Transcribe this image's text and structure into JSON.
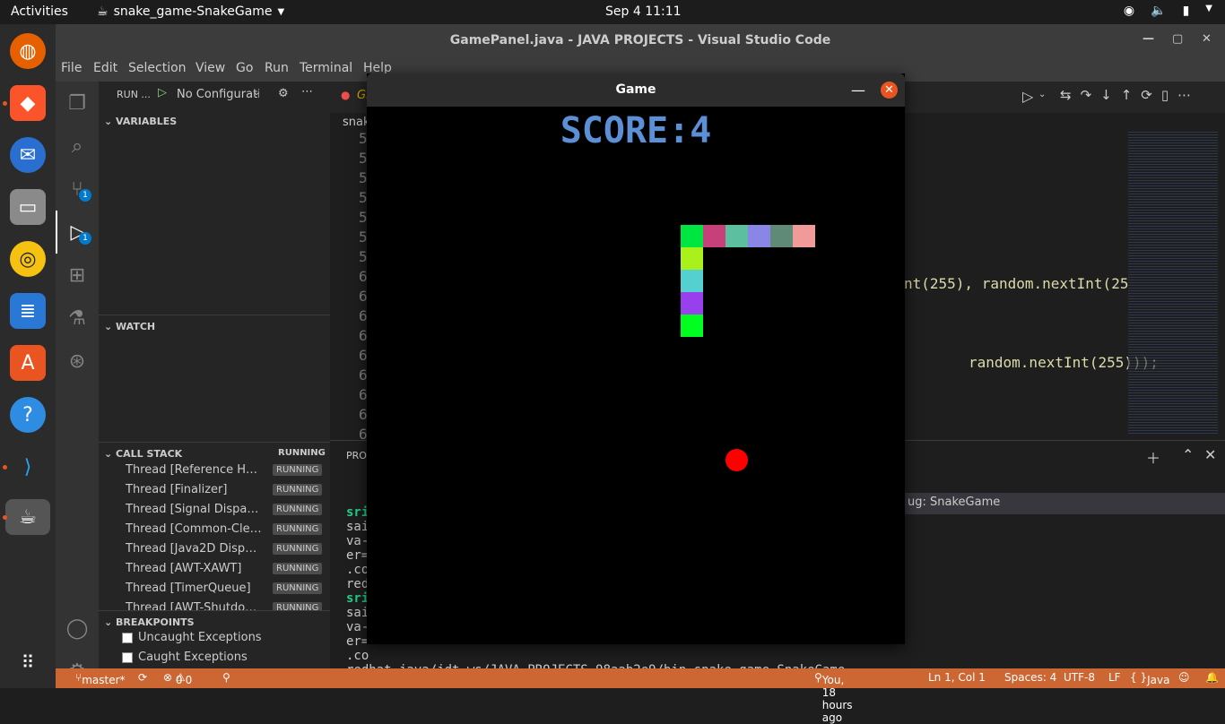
{
  "top": {
    "activities": "Activities",
    "app": "snake_game-SnakeGame",
    "clock": "Sep 4  11:11"
  },
  "window": {
    "title": "GamePanel.java - JAVA PROJECTS - Visual Studio Code"
  },
  "menu": {
    "file": "File",
    "edit": "Edit",
    "selection": "Selection",
    "view": "View",
    "go": "Go",
    "run": "Run",
    "terminal": "Terminal",
    "help": "Help"
  },
  "activity": {
    "scm_badge": "1",
    "debug_badge": "1"
  },
  "sidebar": {
    "run_label": "RUN ...",
    "config": "No Configurati",
    "variables": "VARIABLES",
    "watch": "WATCH",
    "callstack": "CALL STACK",
    "callstack_status": "RUNNING",
    "threads": [
      {
        "name": "Thread [Reference Han...",
        "state": "RUNNING"
      },
      {
        "name": "Thread [Finalizer]",
        "state": "RUNNING"
      },
      {
        "name": "Thread [Signal Dispatch...",
        "state": "RUNNING"
      },
      {
        "name": "Thread [Common-Clean...",
        "state": "RUNNING"
      },
      {
        "name": "Thread [Java2D Disposer]",
        "state": "RUNNING"
      },
      {
        "name": "Thread [AWT-XAWT]",
        "state": "RUNNING"
      },
      {
        "name": "Thread [TimerQueue]",
        "state": "RUNNING"
      },
      {
        "name": "Thread [AWT-Shutdown]",
        "state": "RUNNING"
      }
    ],
    "breakpoints": "BREAKPOINTS",
    "bp1": "Uncaught Exceptions",
    "bp2": "Caught Exceptions"
  },
  "editor": {
    "tab": "Gi",
    "breadcrumb": "snak",
    "line_numbers": [
      "5",
      "5",
      "5",
      "5",
      "5",
      "5",
      "5",
      "6",
      "6",
      "6",
      "6",
      "6",
      "6",
      "6",
      "6",
      "6"
    ],
    "code1": "nt(255), random.nextInt(25",
    "code2": "random.nextInt(255)));"
  },
  "panel": {
    "tab": "PRO",
    "debug_console": "ug: SnakeGame",
    "term_lines": [
      "sri",
      "sai",
      "va-",
      "er=",
      ".co",
      "red",
      "sri",
      "sai",
      "va-",
      "er=",
      ".co"
    ],
    "last_line": "redhat.java/jdt_ws/JAVA PROJECTS_98aab2e9/bin  snake_game.SnakeGame"
  },
  "status": {
    "branch": "master*",
    "errors": "0",
    "warnings": "0",
    "blame": "You, 18 hours ago",
    "position": "Ln 1, Col 1",
    "spaces": "Spaces: 4",
    "encoding": "UTF-8",
    "eol": "LF",
    "lang": "Java"
  },
  "game": {
    "title": "Game",
    "score_text": "SCORE:4",
    "snake": [
      {
        "col": 14,
        "row": 5,
        "color": "#00e640"
      },
      {
        "col": 15,
        "row": 5,
        "color": "#c8407a"
      },
      {
        "col": 16,
        "row": 5,
        "color": "#5bbfa0"
      },
      {
        "col": 17,
        "row": 5,
        "color": "#8a86e8"
      },
      {
        "col": 18,
        "row": 5,
        "color": "#5f8a78"
      },
      {
        "col": 19,
        "row": 5,
        "color": "#f09a9a"
      },
      {
        "col": 14,
        "row": 6,
        "color": "#aaf01a"
      },
      {
        "col": 14,
        "row": 7,
        "color": "#55d0d0"
      },
      {
        "col": 14,
        "row": 8,
        "color": "#9940ee"
      },
      {
        "col": 14,
        "row": 9,
        "color": "#00ff20"
      }
    ],
    "apple": {
      "col": 16,
      "row": 15,
      "color": "#ff0000"
    }
  }
}
